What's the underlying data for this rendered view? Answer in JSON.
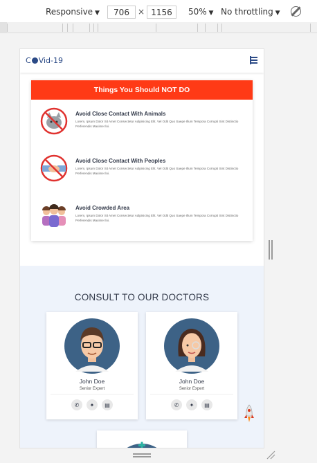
{
  "devtools": {
    "device": "Responsive",
    "width": "706",
    "height": "1156",
    "times": "×",
    "zoom": "50%",
    "throttling": "No throttling"
  },
  "page": {
    "brand": {
      "prefix": "C",
      "suffix": "Vid-19"
    },
    "dont_card": {
      "title": "Things You Should NOT DO",
      "items": [
        {
          "heading": "Avoid Close Contact With Animals",
          "text": "Lorem, Ipsum Dolor Sit Amet Consectetur Adipisicing Elit. Vel Odit Quo Saepe Illum Tempora Corrupti Sint Distinctio Perferendis Maxime Iloi."
        },
        {
          "heading": "Avoid Close Contact With Peoples",
          "text": "Lorem, Ipsum Dolor Sit Amet Consectetur Adipisicing Elit. Vel Odit Quo Saepe Illum Tempora Corrupti Sint Distinctio Perferendis Maxime Iloi."
        },
        {
          "heading": "Avoid Crowded Area",
          "text": "Lorem, Ipsum Dolor Sit Amet Consectetur Adipisicing Elit. Vel Odit Quo Saepe Illum Tempora Corrupti Sint Distinctio Perferendis Maxime Iloi."
        }
      ]
    },
    "consult": {
      "title": "CONSULT TO OUR DOCTORS",
      "doctors": [
        {
          "name": "John Doe",
          "role": "Senior Expert"
        },
        {
          "name": "John Doe",
          "role": "Senior Expert"
        }
      ],
      "social_icons": [
        "whatsapp-icon",
        "twitter-icon",
        "linkedin-icon"
      ]
    }
  },
  "colors": {
    "accent_red": "#ff3a16",
    "brand_blue": "#2b4a86",
    "section_bg": "#eef3fb"
  }
}
